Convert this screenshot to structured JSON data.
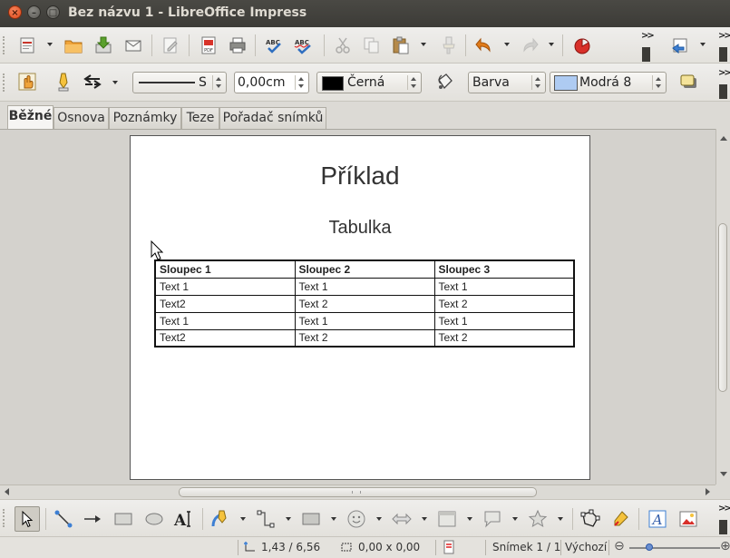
{
  "window": {
    "title": "Bez názvu 1 - LibreOffice Impress",
    "close_glyph": "×",
    "minimize_glyph": "–",
    "maximize_glyph": "□"
  },
  "formatting_toolbar": {
    "line_style_suffix": "S",
    "line_width": "0,00cm",
    "line_color": "Černá",
    "line_color_hex": "#000000",
    "area_style": "Barva",
    "area_color": "Modrá 8",
    "area_color_hex": "#aecbf2"
  },
  "view_tabs": [
    {
      "label": "Běžné",
      "active": true
    },
    {
      "label": "Osnova",
      "active": false
    },
    {
      "label": "Poznámky",
      "active": false
    },
    {
      "label": "Teze",
      "active": false
    },
    {
      "label": "Pořadač snímků",
      "active": false
    }
  ],
  "slide": {
    "title": "Příklad",
    "subtitle": "Tabulka",
    "table": {
      "headers": [
        "Sloupec 1",
        "Sloupec 2",
        "Sloupec 3"
      ],
      "rows": [
        [
          "Text 1",
          "Text 1",
          "Text 1"
        ],
        [
          "Text2",
          "Text 2",
          "Text 2"
        ],
        [
          "Text 1",
          "Text 1",
          "Text 1"
        ],
        [
          "Text2",
          "Text 2",
          "Text 2"
        ]
      ]
    }
  },
  "statusbar": {
    "position": "1,43 / 6,56",
    "size": "0,00 x 0,00",
    "slide_counter": "Snímek 1 / 1",
    "master": "Výchozí",
    "zoom_minus": "⊖",
    "zoom_plus": "⊕"
  },
  "icons": {
    "toolbar1": [
      "templates-icon",
      "open-icon",
      "save-icon",
      "email-icon",
      "edit-file-icon",
      "export-pdf-icon",
      "print-icon",
      "spellcheck-icon",
      "autospell-icon",
      "cut-icon",
      "copy-icon",
      "paste-icon",
      "clone-format-icon",
      "undo-icon",
      "redo-icon",
      "chart-icon",
      "slide-layout-icon"
    ],
    "drawbar": [
      "select-icon",
      "line-icon",
      "arrow-line-icon",
      "rectangle-icon",
      "ellipse-icon",
      "text-icon",
      "curve-icon",
      "connector-icon",
      "basic-shapes-icon",
      "symbol-shapes-icon",
      "block-arrows-icon",
      "flowchart-icon",
      "callout-icon",
      "stars-icon",
      "points-icon",
      "gallery-icon",
      "fontwork-icon",
      "image-icon"
    ]
  }
}
